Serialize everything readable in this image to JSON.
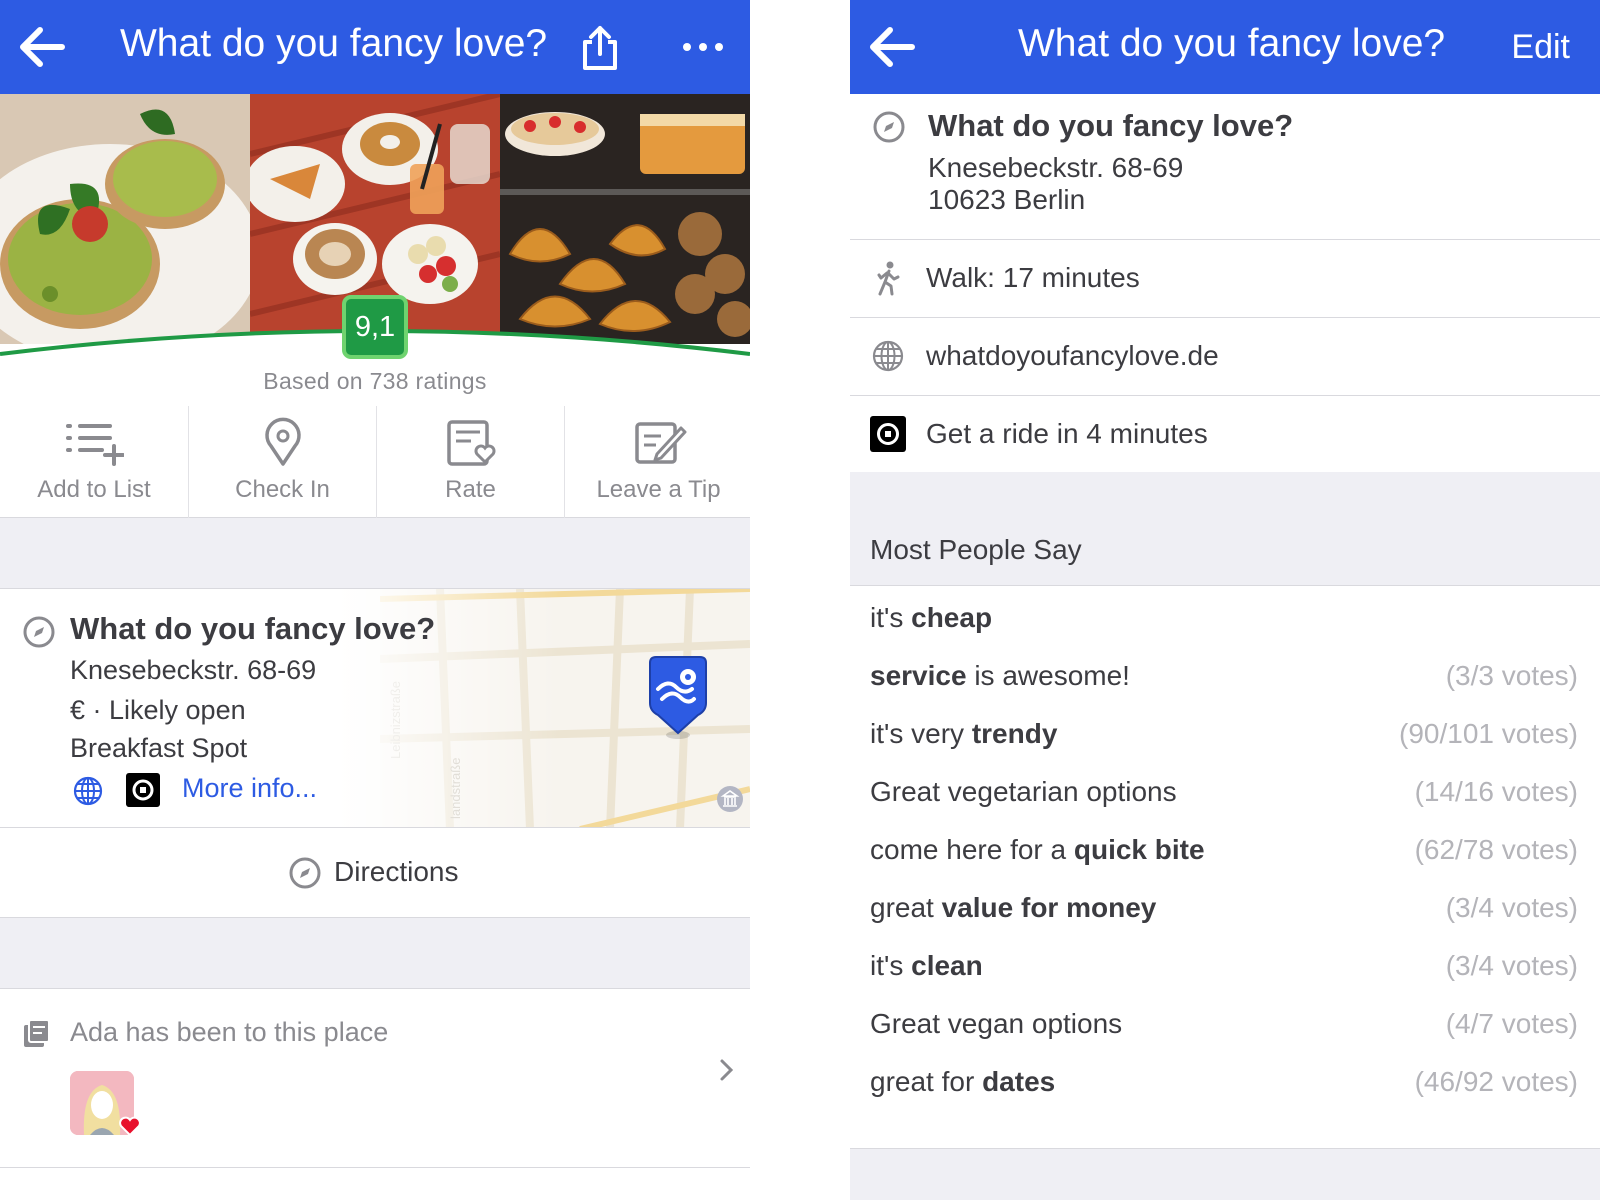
{
  "left": {
    "header": {
      "title": "What do you fancy love?",
      "icons": [
        "back-arrow-icon",
        "share-icon",
        "more-icon"
      ]
    },
    "rating": {
      "score": "9,1",
      "based_on": "Based on 738 ratings"
    },
    "actions": [
      {
        "label": "Add to List",
        "icon": "add-to-list-icon"
      },
      {
        "label": "Check In",
        "icon": "check-in-icon"
      },
      {
        "label": "Rate",
        "icon": "rate-icon"
      },
      {
        "label": "Leave a Tip",
        "icon": "leave-tip-icon"
      }
    ],
    "info": {
      "name": "What do you fancy love?",
      "address": "Knesebeckstr. 68-69",
      "price_status": "€ · Likely open",
      "category": "Breakfast Spot",
      "more_info": "More info..."
    },
    "directions": "Directions",
    "visited": "Ada has been to this place",
    "colors": {
      "accent": "#2d5be3",
      "rating_green": "#1f9a45"
    }
  },
  "right": {
    "header": {
      "title": "What do you fancy love?",
      "edit": "Edit"
    },
    "venue": {
      "name": "What do you fancy love?",
      "address_line1": "Knesebeckstr. 68-69",
      "address_line2": "10623 Berlin"
    },
    "rows": [
      {
        "label": "Walk: 17 minutes",
        "icon": "walk-icon"
      },
      {
        "label": "whatdoyoufancylove.de",
        "icon": "globe-icon"
      },
      {
        "label": "Get a ride in 4 minutes",
        "icon": "uber-icon"
      }
    ],
    "section_title": "Most People Say",
    "tips": [
      {
        "pre": "it's ",
        "bold": "cheap",
        "post": "",
        "votes": ""
      },
      {
        "pre": "",
        "bold": "service",
        "post": " is awesome!",
        "votes": "(3/3 votes)"
      },
      {
        "pre": "it's very ",
        "bold": "trendy",
        "post": "",
        "votes": "(90/101 votes)"
      },
      {
        "pre": "Great vegetarian options",
        "bold": "",
        "post": "",
        "votes": "(14/16 votes)"
      },
      {
        "pre": "come here for a ",
        "bold": "quick bite",
        "post": "",
        "votes": "(62/78 votes)"
      },
      {
        "pre": "great ",
        "bold": "value for money",
        "post": "",
        "votes": "(3/4 votes)"
      },
      {
        "pre": "it's ",
        "bold": "clean",
        "post": "",
        "votes": "(3/4 votes)"
      },
      {
        "pre": "Great vegan options",
        "bold": "",
        "post": "",
        "votes": "(4/7 votes)"
      },
      {
        "pre": "great for ",
        "bold": "dates",
        "post": "",
        "votes": "(46/92 votes)"
      }
    ]
  }
}
